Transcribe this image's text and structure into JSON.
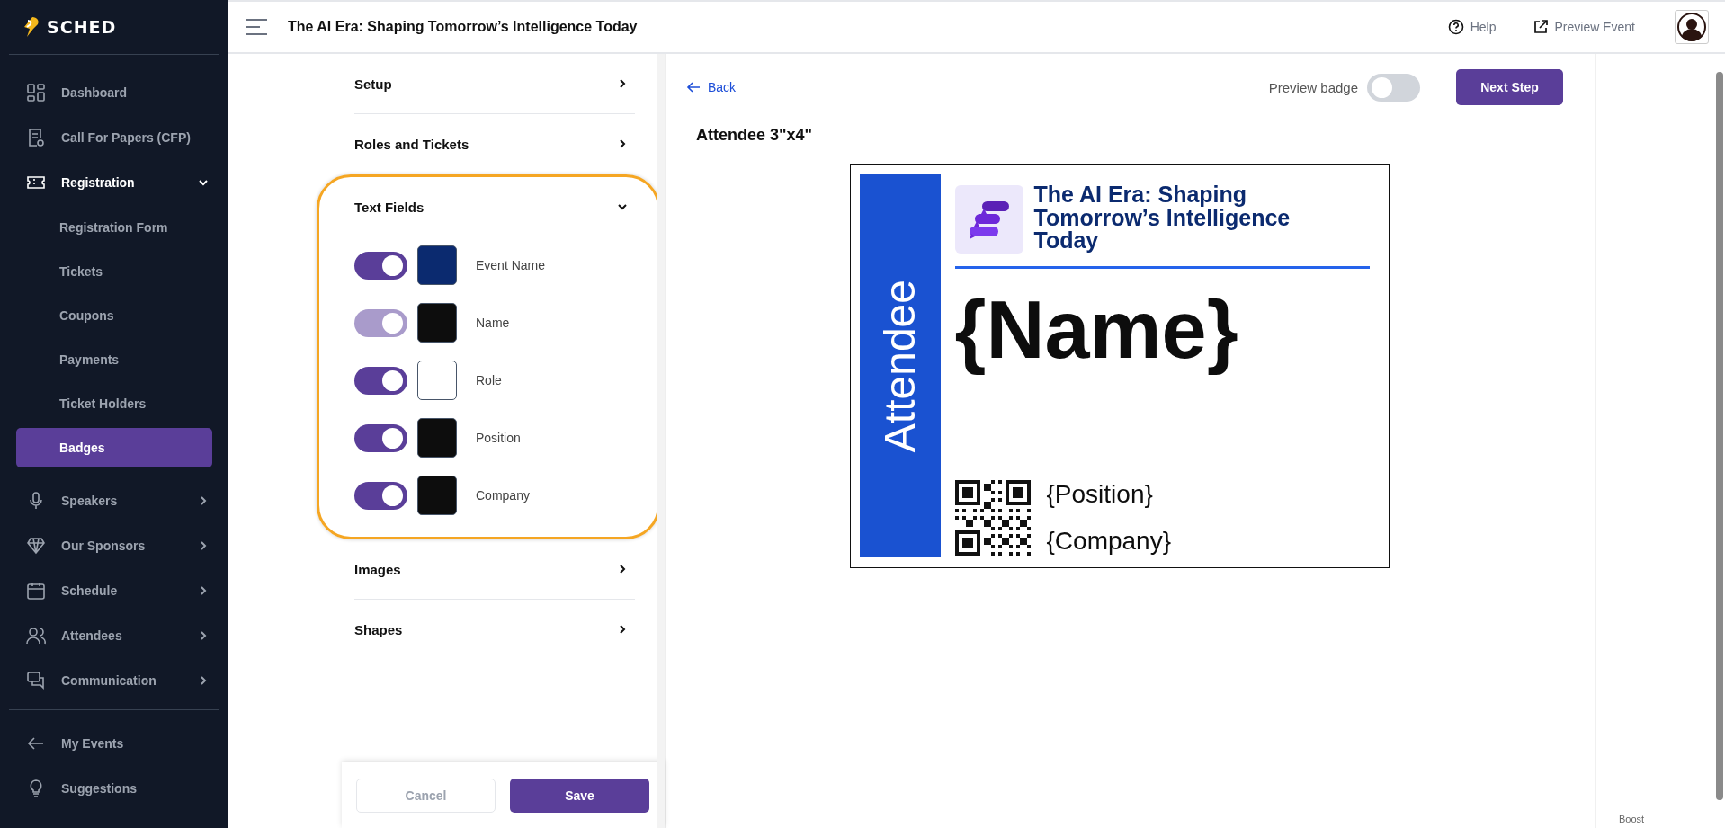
{
  "sidebar": {
    "logo": "SCHED",
    "items": [
      {
        "label": "Dashboard",
        "selected": false
      },
      {
        "label": "Call For Papers (CFP)",
        "selected": false
      },
      {
        "label": "Registration",
        "selected": true,
        "expanded": true,
        "children": [
          {
            "label": "Registration Form",
            "selected": false
          },
          {
            "label": "Tickets",
            "selected": false
          },
          {
            "label": "Coupons",
            "selected": false
          },
          {
            "label": "Payments",
            "selected": false
          },
          {
            "label": "Ticket Holders",
            "selected": false
          },
          {
            "label": "Badges",
            "selected": true
          }
        ]
      },
      {
        "label": "Speakers",
        "selected": false,
        "expanded": false
      },
      {
        "label": "Our Sponsors",
        "selected": false,
        "expanded": false
      },
      {
        "label": "Schedule",
        "selected": false,
        "expanded": false
      },
      {
        "label": "Attendees",
        "selected": false,
        "expanded": false
      },
      {
        "label": "Communication",
        "selected": false,
        "expanded": false
      }
    ],
    "footer_items": [
      {
        "label": "My Events",
        "selected": false
      },
      {
        "label": "Suggestions",
        "selected": false
      }
    ]
  },
  "header": {
    "title": "The AI Era: Shaping Tomorrow’s Intelligence Today",
    "help": "Help",
    "preview_event": "Preview Event"
  },
  "settings": {
    "sections": [
      {
        "title": "Setup",
        "expanded": false,
        "highlighted": false
      },
      {
        "title": "Roles and Tickets",
        "expanded": false,
        "highlighted": false
      },
      {
        "title": "Text Fields",
        "expanded": true,
        "highlighted": true,
        "fields": [
          {
            "label": "Event Name",
            "on": true,
            "disabled": false,
            "color": "#0b2a6f"
          },
          {
            "label": "Name",
            "on": true,
            "disabled": true,
            "color": "#0d0d0d"
          },
          {
            "label": "Role",
            "on": true,
            "disabled": false,
            "color": "#ffffff"
          },
          {
            "label": "Position",
            "on": true,
            "disabled": false,
            "color": "#0d0d0d"
          },
          {
            "label": "Company",
            "on": true,
            "disabled": false,
            "color": "#0d0d0d"
          }
        ]
      },
      {
        "title": "Images",
        "expanded": false,
        "highlighted": false
      },
      {
        "title": "Shapes",
        "expanded": false,
        "highlighted": false
      }
    ],
    "cancel": {
      "label": "Cancel",
      "disabled": true
    },
    "save": {
      "label": "Save"
    }
  },
  "preview": {
    "back": "Back",
    "toggle_label": "Preview badge",
    "toggle_on": false,
    "next_step": "Next Step",
    "badge_type": "Attendee 3\"x4\"",
    "badge": {
      "role": "Attendee",
      "event_name": "The AI Era: Shaping Tomorrow’s Intelligence Today",
      "name": "{Name}",
      "position": "{Position}",
      "company": "{Company}"
    }
  },
  "boost": "Boost"
}
